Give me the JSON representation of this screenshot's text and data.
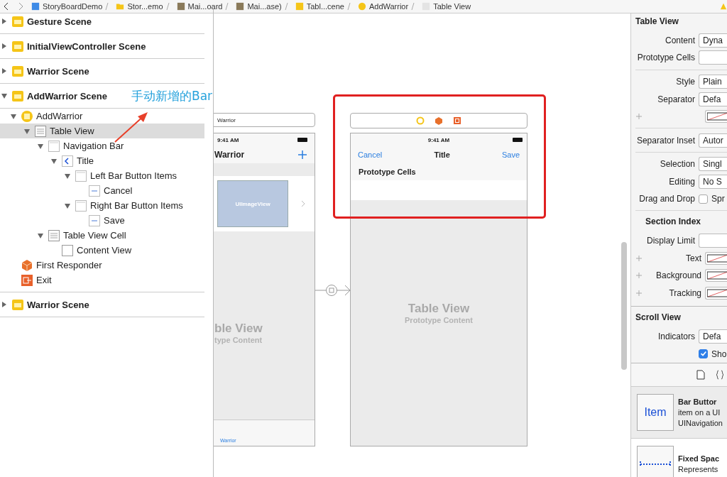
{
  "breadcrumb": [
    {
      "label": "StoryBoardDemo",
      "kind": "project"
    },
    {
      "label": "Stor...emo",
      "kind": "folder"
    },
    {
      "label": "Mai...oard",
      "kind": "storyboard"
    },
    {
      "label": "Mai...ase)",
      "kind": "storyboard"
    },
    {
      "label": "Tabl...cene",
      "kind": "scene"
    },
    {
      "label": "AddWarrior",
      "kind": "controller"
    },
    {
      "label": "Table View",
      "kind": "table"
    }
  ],
  "outline": [
    {
      "label": "Gesture Scene",
      "kind": "scene",
      "expanded": false,
      "selected": false
    },
    {
      "label": "InitialViewController Scene",
      "kind": "scene",
      "expanded": false,
      "selected": false
    },
    {
      "label": "Warrior Scene",
      "kind": "scene",
      "expanded": false,
      "selected": false
    },
    {
      "label": "AddWarrior Scene",
      "kind": "scene",
      "expanded": true,
      "selected": false,
      "children": [
        {
          "label": "AddWarrior",
          "kind": "controller",
          "expanded": true,
          "selected": false,
          "children": [
            {
              "label": "Table View",
              "kind": "table",
              "expanded": true,
              "selected": true,
              "children": [
                {
                  "label": "Navigation Bar",
                  "kind": "navbar",
                  "expanded": true,
                  "selected": false,
                  "children": [
                    {
                      "label": "Title",
                      "kind": "navitem",
                      "expanded": true,
                      "selected": false,
                      "children": [
                        {
                          "label": "Left Bar Button Items",
                          "kind": "navbar",
                          "expanded": true,
                          "selected": false,
                          "children": [
                            {
                              "label": "Cancel",
                              "kind": "baritem",
                              "selected": false
                            }
                          ]
                        },
                        {
                          "label": "Right Bar Button Items",
                          "kind": "navbar",
                          "expanded": true,
                          "selected": false,
                          "children": [
                            {
                              "label": "Save",
                              "kind": "baritem",
                              "selected": false
                            }
                          ]
                        }
                      ]
                    }
                  ]
                },
                {
                  "label": "Table View Cell",
                  "kind": "cell",
                  "expanded": true,
                  "selected": false,
                  "children": [
                    {
                      "label": "Content View",
                      "kind": "view",
                      "selected": false
                    }
                  ]
                }
              ]
            }
          ]
        },
        {
          "label": "First Responder",
          "kind": "responder",
          "selected": false
        },
        {
          "label": "Exit",
          "kind": "exit",
          "selected": false
        }
      ]
    },
    {
      "label": "Warrior Scene",
      "kind": "scene",
      "expanded": false,
      "selected": false
    }
  ],
  "annotation": "手动新增的Bar",
  "left_scene": {
    "title": "Warrior",
    "time": "9:41 AM",
    "nav_title": "Warrior",
    "image_label": "UIImageView",
    "placeholder_title": "ble View",
    "placeholder_subtitle": "type Content",
    "tab_label": "Warrior"
  },
  "right_scene": {
    "time": "9:41 AM",
    "left_button": "Cancel",
    "nav_title": "Title",
    "right_button": "Save",
    "section_header": "Prototype Cells",
    "placeholder_title": "Table View",
    "placeholder_subtitle": "Prototype Content"
  },
  "inspector": [
    {
      "kind": "section",
      "label": "Table View"
    },
    {
      "kind": "popup",
      "label": "Content",
      "value": "Dyna"
    },
    {
      "kind": "field",
      "label": "Prototype Cells"
    },
    {
      "kind": "divider"
    },
    {
      "kind": "popup",
      "label": "Style",
      "value": "Plain"
    },
    {
      "kind": "popup",
      "label": "Separator",
      "value": "Defa"
    },
    {
      "kind": "color"
    },
    {
      "kind": "divider"
    },
    {
      "kind": "popup",
      "label": "Separator Inset",
      "value": "Autor"
    },
    {
      "kind": "divider"
    },
    {
      "kind": "popup",
      "label": "Selection",
      "value": "Singl"
    },
    {
      "kind": "popup",
      "label": "Editing",
      "value": "No S"
    },
    {
      "kind": "check",
      "label": "Drag and Drop",
      "value": "Spr",
      "checked": false
    },
    {
      "kind": "divider"
    },
    {
      "kind": "subsection",
      "label": "Section Index"
    },
    {
      "kind": "field",
      "label": "Display Limit"
    },
    {
      "kind": "color",
      "label": "Text"
    },
    {
      "kind": "color",
      "label": "Background"
    },
    {
      "kind": "color",
      "label": "Tracking"
    },
    {
      "kind": "rule"
    },
    {
      "kind": "section",
      "label": "Scroll View"
    },
    {
      "kind": "popup",
      "label": "Indicators",
      "value": "Defa"
    },
    {
      "kind": "check",
      "value": "Sho",
      "checked": true
    }
  ],
  "library": [
    {
      "kind": "item",
      "icon_text": "Item",
      "title": "Bar Buttor",
      "lines": [
        "item on a UI",
        "UINavigation"
      ],
      "selected": true
    },
    {
      "kind": "fixed",
      "title": "Fixed Spac",
      "lines": [
        "Represents"
      ],
      "selected": false
    }
  ]
}
